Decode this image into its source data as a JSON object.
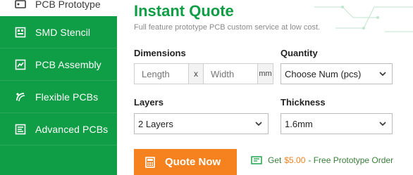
{
  "sidebar": {
    "active": {
      "label": "PCB Prototype"
    },
    "items": [
      {
        "label": "SMD Stencil",
        "icon": "stencil-icon"
      },
      {
        "label": "PCB Assembly",
        "icon": "chip-icon"
      },
      {
        "label": "Flexible PCBs",
        "icon": "flex-icon"
      },
      {
        "label": "Advanced PCBs",
        "icon": "advanced-icon"
      }
    ]
  },
  "header": {
    "title": "Instant Quote",
    "subtitle": "Full feature prototype PCB custom service at low cost."
  },
  "form": {
    "dimensions_label": "Dimensions",
    "length_placeholder": "Length",
    "separator": "x",
    "width_placeholder": "Width",
    "unit": "mm",
    "quantity_label": "Quantity",
    "quantity_value": "Choose Num (pcs)",
    "layers_label": "Layers",
    "layers_value": "2 Layers",
    "thickness_label": "Thickness",
    "thickness_value": "1.6mm"
  },
  "actions": {
    "quote_label": "Quote Now"
  },
  "promo": {
    "prefix": "Get",
    "price": "$5.00",
    "suffix": "- Free Prototype Order"
  },
  "colors": {
    "brand_green": "#0f9d45",
    "accent_orange": "#f6821f"
  }
}
